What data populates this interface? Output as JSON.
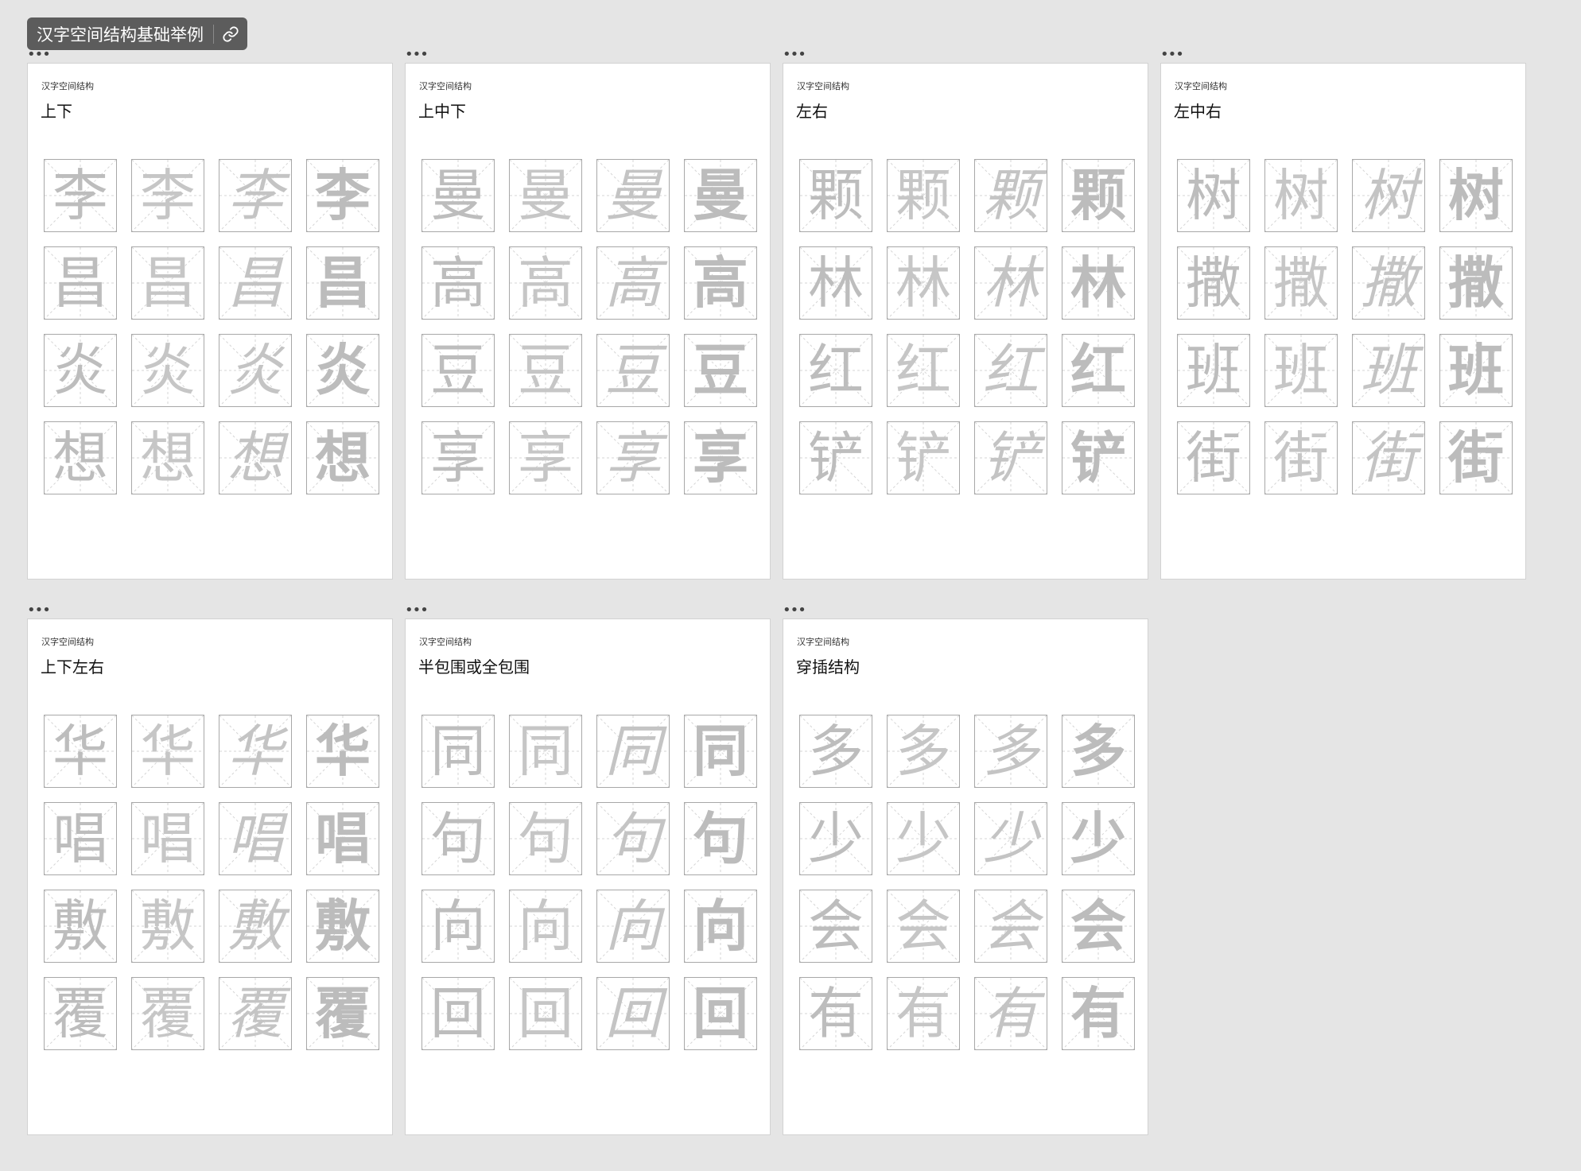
{
  "board_title": "汉字空间结构基础举例",
  "frames": [
    {
      "caption": "汉字空间结构",
      "title": "上下",
      "chars": [
        "李",
        "昌",
        "炎",
        "想"
      ]
    },
    {
      "caption": "汉字空间结构",
      "title": "上中下",
      "chars": [
        "曼",
        "高",
        "豆",
        "享"
      ]
    },
    {
      "caption": "汉字空间结构",
      "title": "左右",
      "chars": [
        "颗",
        "林",
        "红",
        "铲"
      ]
    },
    {
      "caption": "汉字空间结构",
      "title": "左中右",
      "chars": [
        "树",
        "撒",
        "班",
        "街"
      ]
    },
    {
      "caption": "汉字空间结构",
      "title": "上下左右",
      "chars": [
        "华",
        "唱",
        "敷",
        "覆"
      ]
    },
    {
      "caption": "汉字空间结构",
      "title": "半包围或全包围",
      "chars": [
        "同",
        "句",
        "向",
        "回"
      ]
    },
    {
      "caption": "汉字空间结构",
      "title": "穿插结构",
      "chars": [
        "多",
        "少",
        "会",
        "有"
      ]
    }
  ],
  "colors": {
    "canvas_bg": "#e5e5e5",
    "chip_bg": "#5c5c5c",
    "glyph": "#bdbdbd",
    "cell_border": "#a8a8a8",
    "guide_line": "#d6d6d6"
  },
  "icons": {
    "link": "link-icon",
    "frame_handle": "more-horizontal-icon"
  }
}
